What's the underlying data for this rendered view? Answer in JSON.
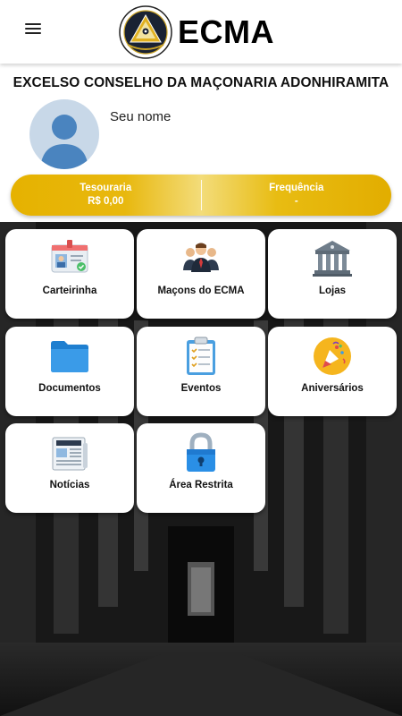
{
  "header": {
    "menu_icon": "hamburger-menu-icon",
    "brand": "ECMA"
  },
  "org_title": "EXCELSO CONSELHO DA MAÇONARIA ADONHIRAMITA",
  "profile": {
    "name": "Seu nome"
  },
  "summary": {
    "treasury_label": "Tesouraria",
    "treasury_value": "R$ 0,00",
    "frequency_label": "Frequência",
    "frequency_value": "-"
  },
  "menu": [
    {
      "label": "Carteirinha",
      "icon": "id-card-icon"
    },
    {
      "label": "Maçons do ECMA",
      "icon": "members-group-icon"
    },
    {
      "label": "Lojas",
      "icon": "temple-icon"
    },
    {
      "label": "Documentos",
      "icon": "folder-icon"
    },
    {
      "label": "Eventos",
      "icon": "clipboard-checklist-icon"
    },
    {
      "label": "Aniversários",
      "icon": "party-popper-icon"
    },
    {
      "label": "Notícias",
      "icon": "newspaper-icon"
    },
    {
      "label": "Área Restrita",
      "icon": "padlock-icon"
    }
  ],
  "colors": {
    "gold": "#e6b200",
    "folder_blue": "#2e8fe0",
    "avatar_bg": "#c8d8e8",
    "avatar_figure": "#4a84bf"
  }
}
